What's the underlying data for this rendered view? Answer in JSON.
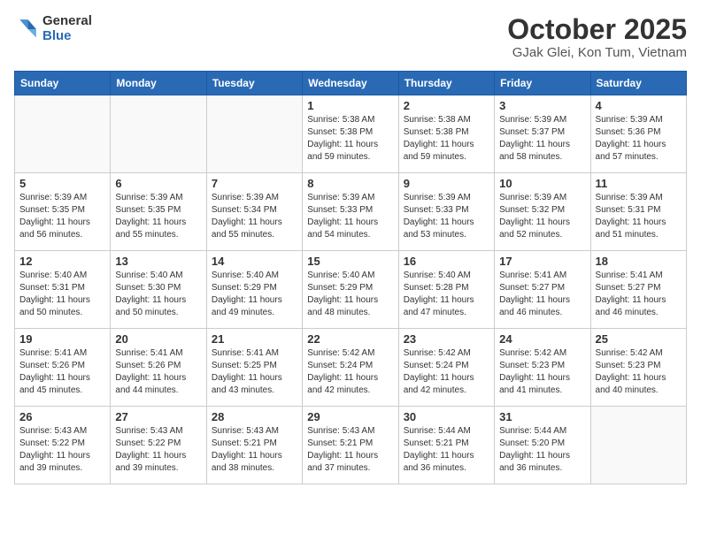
{
  "header": {
    "logo_general": "General",
    "logo_blue": "Blue",
    "month_title": "October 2025",
    "location": "GJak Glei, Kon Tum, Vietnam"
  },
  "calendar": {
    "weekdays": [
      "Sunday",
      "Monday",
      "Tuesday",
      "Wednesday",
      "Thursday",
      "Friday",
      "Saturday"
    ],
    "weeks": [
      [
        {
          "day": "",
          "info": ""
        },
        {
          "day": "",
          "info": ""
        },
        {
          "day": "",
          "info": ""
        },
        {
          "day": "1",
          "info": "Sunrise: 5:38 AM\nSunset: 5:38 PM\nDaylight: 11 hours\nand 59 minutes."
        },
        {
          "day": "2",
          "info": "Sunrise: 5:38 AM\nSunset: 5:38 PM\nDaylight: 11 hours\nand 59 minutes."
        },
        {
          "day": "3",
          "info": "Sunrise: 5:39 AM\nSunset: 5:37 PM\nDaylight: 11 hours\nand 58 minutes."
        },
        {
          "day": "4",
          "info": "Sunrise: 5:39 AM\nSunset: 5:36 PM\nDaylight: 11 hours\nand 57 minutes."
        }
      ],
      [
        {
          "day": "5",
          "info": "Sunrise: 5:39 AM\nSunset: 5:35 PM\nDaylight: 11 hours\nand 56 minutes."
        },
        {
          "day": "6",
          "info": "Sunrise: 5:39 AM\nSunset: 5:35 PM\nDaylight: 11 hours\nand 55 minutes."
        },
        {
          "day": "7",
          "info": "Sunrise: 5:39 AM\nSunset: 5:34 PM\nDaylight: 11 hours\nand 55 minutes."
        },
        {
          "day": "8",
          "info": "Sunrise: 5:39 AM\nSunset: 5:33 PM\nDaylight: 11 hours\nand 54 minutes."
        },
        {
          "day": "9",
          "info": "Sunrise: 5:39 AM\nSunset: 5:33 PM\nDaylight: 11 hours\nand 53 minutes."
        },
        {
          "day": "10",
          "info": "Sunrise: 5:39 AM\nSunset: 5:32 PM\nDaylight: 11 hours\nand 52 minutes."
        },
        {
          "day": "11",
          "info": "Sunrise: 5:39 AM\nSunset: 5:31 PM\nDaylight: 11 hours\nand 51 minutes."
        }
      ],
      [
        {
          "day": "12",
          "info": "Sunrise: 5:40 AM\nSunset: 5:31 PM\nDaylight: 11 hours\nand 50 minutes."
        },
        {
          "day": "13",
          "info": "Sunrise: 5:40 AM\nSunset: 5:30 PM\nDaylight: 11 hours\nand 50 minutes."
        },
        {
          "day": "14",
          "info": "Sunrise: 5:40 AM\nSunset: 5:29 PM\nDaylight: 11 hours\nand 49 minutes."
        },
        {
          "day": "15",
          "info": "Sunrise: 5:40 AM\nSunset: 5:29 PM\nDaylight: 11 hours\nand 48 minutes."
        },
        {
          "day": "16",
          "info": "Sunrise: 5:40 AM\nSunset: 5:28 PM\nDaylight: 11 hours\nand 47 minutes."
        },
        {
          "day": "17",
          "info": "Sunrise: 5:41 AM\nSunset: 5:27 PM\nDaylight: 11 hours\nand 46 minutes."
        },
        {
          "day": "18",
          "info": "Sunrise: 5:41 AM\nSunset: 5:27 PM\nDaylight: 11 hours\nand 46 minutes."
        }
      ],
      [
        {
          "day": "19",
          "info": "Sunrise: 5:41 AM\nSunset: 5:26 PM\nDaylight: 11 hours\nand 45 minutes."
        },
        {
          "day": "20",
          "info": "Sunrise: 5:41 AM\nSunset: 5:26 PM\nDaylight: 11 hours\nand 44 minutes."
        },
        {
          "day": "21",
          "info": "Sunrise: 5:41 AM\nSunset: 5:25 PM\nDaylight: 11 hours\nand 43 minutes."
        },
        {
          "day": "22",
          "info": "Sunrise: 5:42 AM\nSunset: 5:24 PM\nDaylight: 11 hours\nand 42 minutes."
        },
        {
          "day": "23",
          "info": "Sunrise: 5:42 AM\nSunset: 5:24 PM\nDaylight: 11 hours\nand 42 minutes."
        },
        {
          "day": "24",
          "info": "Sunrise: 5:42 AM\nSunset: 5:23 PM\nDaylight: 11 hours\nand 41 minutes."
        },
        {
          "day": "25",
          "info": "Sunrise: 5:42 AM\nSunset: 5:23 PM\nDaylight: 11 hours\nand 40 minutes."
        }
      ],
      [
        {
          "day": "26",
          "info": "Sunrise: 5:43 AM\nSunset: 5:22 PM\nDaylight: 11 hours\nand 39 minutes."
        },
        {
          "day": "27",
          "info": "Sunrise: 5:43 AM\nSunset: 5:22 PM\nDaylight: 11 hours\nand 39 minutes."
        },
        {
          "day": "28",
          "info": "Sunrise: 5:43 AM\nSunset: 5:21 PM\nDaylight: 11 hours\nand 38 minutes."
        },
        {
          "day": "29",
          "info": "Sunrise: 5:43 AM\nSunset: 5:21 PM\nDaylight: 11 hours\nand 37 minutes."
        },
        {
          "day": "30",
          "info": "Sunrise: 5:44 AM\nSunset: 5:21 PM\nDaylight: 11 hours\nand 36 minutes."
        },
        {
          "day": "31",
          "info": "Sunrise: 5:44 AM\nSunset: 5:20 PM\nDaylight: 11 hours\nand 36 minutes."
        },
        {
          "day": "",
          "info": ""
        }
      ]
    ]
  }
}
